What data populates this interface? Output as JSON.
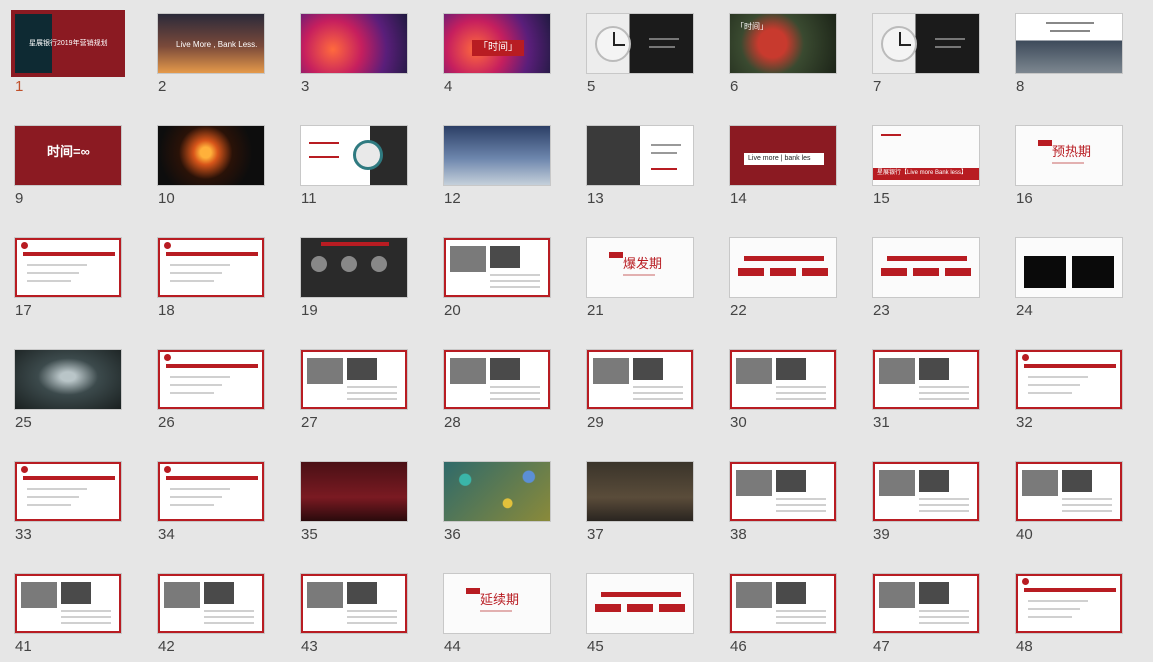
{
  "selected_slide": "1",
  "slides": [
    {
      "num": "1",
      "style": "red-cover",
      "caption": "星展银行2019年营销规划"
    },
    {
      "num": "2",
      "style": "sunset",
      "caption": "Live More , Bank Less."
    },
    {
      "num": "3",
      "style": "colorful",
      "caption": ""
    },
    {
      "num": "4",
      "style": "colorful-title",
      "caption": "「时间」"
    },
    {
      "num": "5",
      "style": "clock-dark",
      "caption": ""
    },
    {
      "num": "6",
      "style": "plant",
      "caption": "「时间」"
    },
    {
      "num": "7",
      "style": "clock-dark",
      "caption": ""
    },
    {
      "num": "8",
      "style": "city-text",
      "caption": ""
    },
    {
      "num": "9",
      "style": "red-title",
      "caption": "时间=∞"
    },
    {
      "num": "10",
      "style": "fire",
      "caption": ""
    },
    {
      "num": "11",
      "style": "white-diagram",
      "caption": ""
    },
    {
      "num": "12",
      "style": "sky",
      "caption": ""
    },
    {
      "num": "13",
      "style": "clock-white",
      "caption": ""
    },
    {
      "num": "14",
      "style": "red-live",
      "caption": "Live more | bank les"
    },
    {
      "num": "15",
      "style": "white-bar",
      "caption": "星展银行【Live more Bank less】"
    },
    {
      "num": "16",
      "style": "white-phase",
      "caption": "预热期"
    },
    {
      "num": "17",
      "style": "red-frame-list",
      "caption": ""
    },
    {
      "num": "18",
      "style": "red-frame-list",
      "caption": ""
    },
    {
      "num": "19",
      "style": "dark-people",
      "caption": ""
    },
    {
      "num": "20",
      "style": "red-frame-photos",
      "caption": ""
    },
    {
      "num": "21",
      "style": "white-phase",
      "caption": "爆发期"
    },
    {
      "num": "22",
      "style": "white-red-blocks",
      "caption": ""
    },
    {
      "num": "23",
      "style": "white-red-blocks",
      "caption": ""
    },
    {
      "num": "24",
      "style": "white-dark-boxes",
      "caption": ""
    },
    {
      "num": "25",
      "style": "tunnel",
      "caption": ""
    },
    {
      "num": "26",
      "style": "red-frame-list",
      "caption": ""
    },
    {
      "num": "27",
      "style": "red-frame-photos",
      "caption": ""
    },
    {
      "num": "28",
      "style": "red-frame-photos",
      "caption": ""
    },
    {
      "num": "29",
      "style": "red-frame-photos",
      "caption": ""
    },
    {
      "num": "30",
      "style": "red-frame-photos",
      "caption": ""
    },
    {
      "num": "31",
      "style": "red-frame-photos",
      "caption": ""
    },
    {
      "num": "32",
      "style": "red-frame-list",
      "caption": ""
    },
    {
      "num": "33",
      "style": "red-frame-list",
      "caption": ""
    },
    {
      "num": "34",
      "style": "red-frame-list",
      "caption": ""
    },
    {
      "num": "35",
      "style": "stage",
      "caption": ""
    },
    {
      "num": "36",
      "style": "balls",
      "caption": ""
    },
    {
      "num": "37",
      "style": "ruins",
      "caption": ""
    },
    {
      "num": "38",
      "style": "red-frame-photos",
      "caption": ""
    },
    {
      "num": "39",
      "style": "red-frame-photos",
      "caption": ""
    },
    {
      "num": "40",
      "style": "red-frame-photos",
      "caption": ""
    },
    {
      "num": "41",
      "style": "red-frame-photos",
      "caption": ""
    },
    {
      "num": "42",
      "style": "red-frame-photos",
      "caption": ""
    },
    {
      "num": "43",
      "style": "red-frame-photos",
      "caption": ""
    },
    {
      "num": "44",
      "style": "white-phase",
      "caption": "延续期"
    },
    {
      "num": "45",
      "style": "white-red-blocks",
      "caption": ""
    },
    {
      "num": "46",
      "style": "red-frame-photos",
      "caption": ""
    },
    {
      "num": "47",
      "style": "red-frame-photos",
      "caption": ""
    },
    {
      "num": "48",
      "style": "red-frame-list",
      "caption": ""
    }
  ]
}
